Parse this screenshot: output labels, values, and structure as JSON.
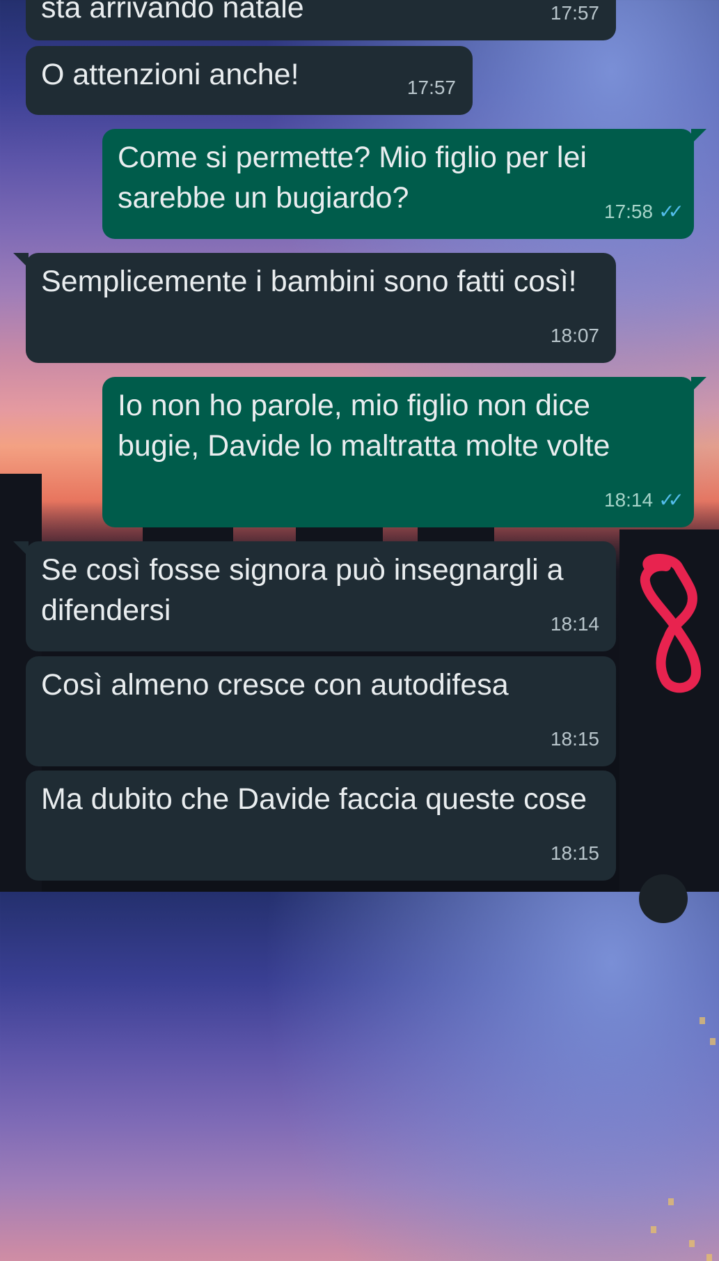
{
  "messages": [
    {
      "text": "sta arrivando natale",
      "time": "17:57"
    },
    {
      "text": "O attenzioni anche!",
      "time": "17:57"
    },
    {
      "text": "Come si permette? Mio figlio per lei sarebbe un bugiardo?",
      "time": "17:58",
      "ticks": "✓✓"
    },
    {
      "text": "Semplicemente i bambini sono fatti così!",
      "time": "18:07"
    },
    {
      "text": "Io non ho parole, mio figlio non dice bugie, Davide lo maltratta molte volte",
      "time": "18:14",
      "ticks": "✓✓"
    },
    {
      "text": "Se così fosse signora può insegnargli a difendersi",
      "time": "18:14"
    },
    {
      "text": "Così almeno cresce con autodifesa",
      "time": "18:15"
    },
    {
      "text": "Ma dubito che Davide faccia queste cose",
      "time": "18:15"
    }
  ],
  "colors": {
    "incoming_bubble": "#1f2c34",
    "outgoing_bubble": "#005c4b",
    "read_ticks": "#53bdeb",
    "annotation": "#e8234f"
  }
}
